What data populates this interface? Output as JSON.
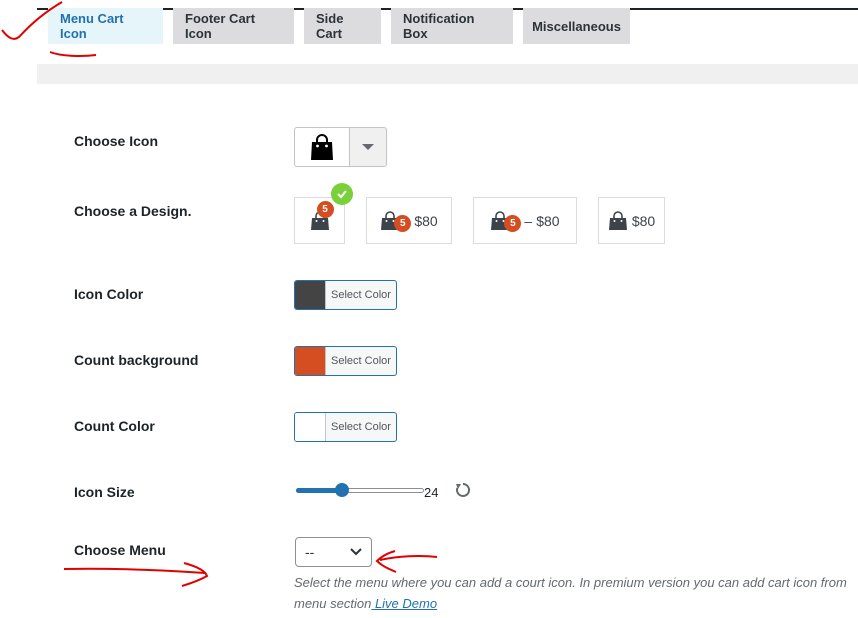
{
  "tabs": [
    {
      "label": "Menu Cart Icon",
      "active": true
    },
    {
      "label": "Footer Cart Icon",
      "active": false
    },
    {
      "label": "Side Cart",
      "active": false
    },
    {
      "label": "Notification Box",
      "active": false
    },
    {
      "label": "Miscellaneous",
      "active": false
    }
  ],
  "fields": {
    "choose_icon": {
      "label": "Choose Icon",
      "icon": "shopping-bag-icon"
    },
    "choose_design": {
      "label": "Choose a Design.",
      "selected_index": 0,
      "options": [
        {
          "count": "5",
          "price": "",
          "separator": ""
        },
        {
          "count": "5",
          "price": "$80",
          "separator": ""
        },
        {
          "count": "5",
          "price": "$80",
          "separator": "–"
        },
        {
          "count": "",
          "price": "$80",
          "separator": ""
        }
      ]
    },
    "icon_color": {
      "label": "Icon Color",
      "button": "Select Color",
      "color": "#444444"
    },
    "count_background": {
      "label": "Count background",
      "button": "Select Color",
      "color": "#d54e21"
    },
    "count_color": {
      "label": "Count Color",
      "button": "Select Color",
      "color": "#ffffff"
    },
    "icon_size": {
      "label": "Icon Size",
      "value": "24",
      "fraction": 0.36
    },
    "choose_menu": {
      "label": "Choose Menu",
      "selected": "--",
      "description": "Select the menu where you can add a court icon. In premium version you can add cart icon from menu section",
      "link_text": " Live Demo"
    }
  },
  "colors": {
    "accent": "#2271b1",
    "badge": "#d54e21",
    "check": "#7ad03a",
    "annotation": "#e00000"
  }
}
